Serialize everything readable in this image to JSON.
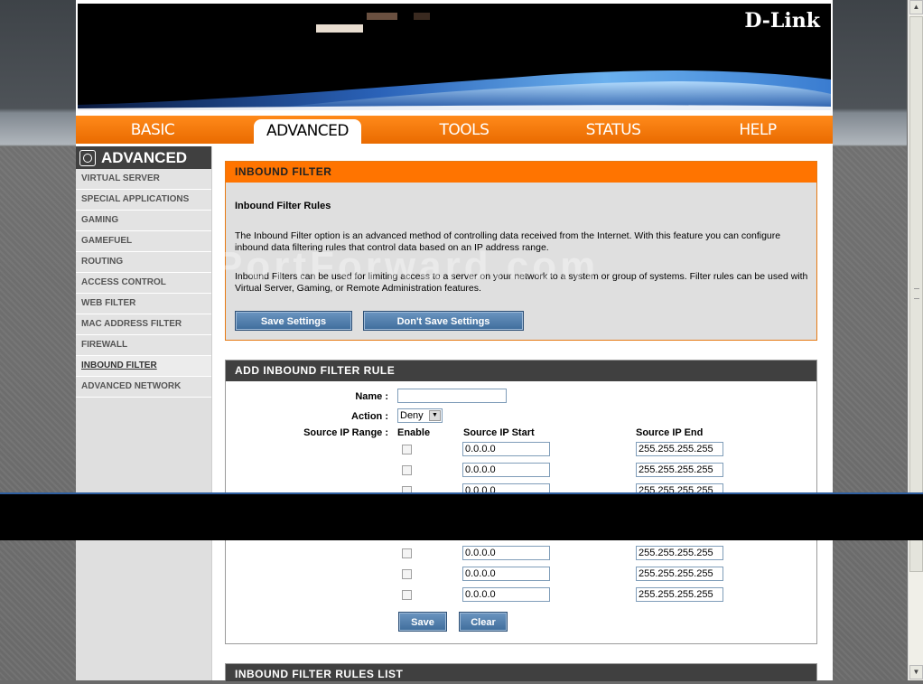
{
  "brand": {
    "logo": "D-Link"
  },
  "nav": {
    "tabs": [
      {
        "label": "BASIC"
      },
      {
        "label": "ADVANCED"
      },
      {
        "label": "TOOLS"
      },
      {
        "label": "STATUS"
      },
      {
        "label": "HELP"
      }
    ],
    "active": "ADVANCED"
  },
  "sidebar": {
    "title": "ADVANCED",
    "items": [
      {
        "label": "VIRTUAL SERVER"
      },
      {
        "label": "SPECIAL APPLICATIONS"
      },
      {
        "label": "GAMING"
      },
      {
        "label": "GAMEFUEL"
      },
      {
        "label": "ROUTING"
      },
      {
        "label": "ACCESS CONTROL"
      },
      {
        "label": "WEB FILTER"
      },
      {
        "label": "MAC ADDRESS FILTER"
      },
      {
        "label": "FIREWALL"
      },
      {
        "label": "INBOUND FILTER"
      },
      {
        "label": "ADVANCED NETWORK"
      }
    ],
    "active": "INBOUND FILTER"
  },
  "inbound_filter": {
    "title": "INBOUND FILTER",
    "subtitle": "Inbound Filter Rules",
    "desc1": "The Inbound Filter option is an advanced method of controlling data received from the Internet. With this feature you can configure inbound data filtering rules that control data based on an IP address range.",
    "desc2": "Inbound Filters can be used for limiting access to a server on your network to a system or group of systems. Filter rules can be used with Virtual Server, Gaming, or Remote Administration features.",
    "save_label": "Save Settings",
    "dont_save_label": "Don't Save Settings"
  },
  "add_rule": {
    "title": "ADD INBOUND FILTER RULE",
    "name_label": "Name :",
    "name_value": "",
    "action_label": "Action :",
    "action_value": "Deny",
    "range_label": "Source IP Range :",
    "col_enable": "Enable",
    "col_start": "Source IP Start",
    "col_end": "Source IP End",
    "rows": [
      {
        "start": "0.0.0.0",
        "end": "255.255.255.255"
      },
      {
        "start": "0.0.0.0",
        "end": "255.255.255.255"
      },
      {
        "start": "0.0.0.0",
        "end": "255.255.255.255"
      },
      {
        "start": "0.0.0.0",
        "end": "255.255.255.255"
      },
      {
        "start": "0.0.0.0",
        "end": "255.255.255.255"
      },
      {
        "start": "0.0.0.0",
        "end": "255.255.255.255"
      }
    ],
    "save_label": "Save",
    "clear_label": "Clear"
  },
  "rules_list": {
    "title": "INBOUND FILTER RULES LIST"
  },
  "watermark": "PortForward.com",
  "colors": {
    "accent": "#ff7400",
    "button": "#4a76a3",
    "dark_header": "#404040"
  }
}
